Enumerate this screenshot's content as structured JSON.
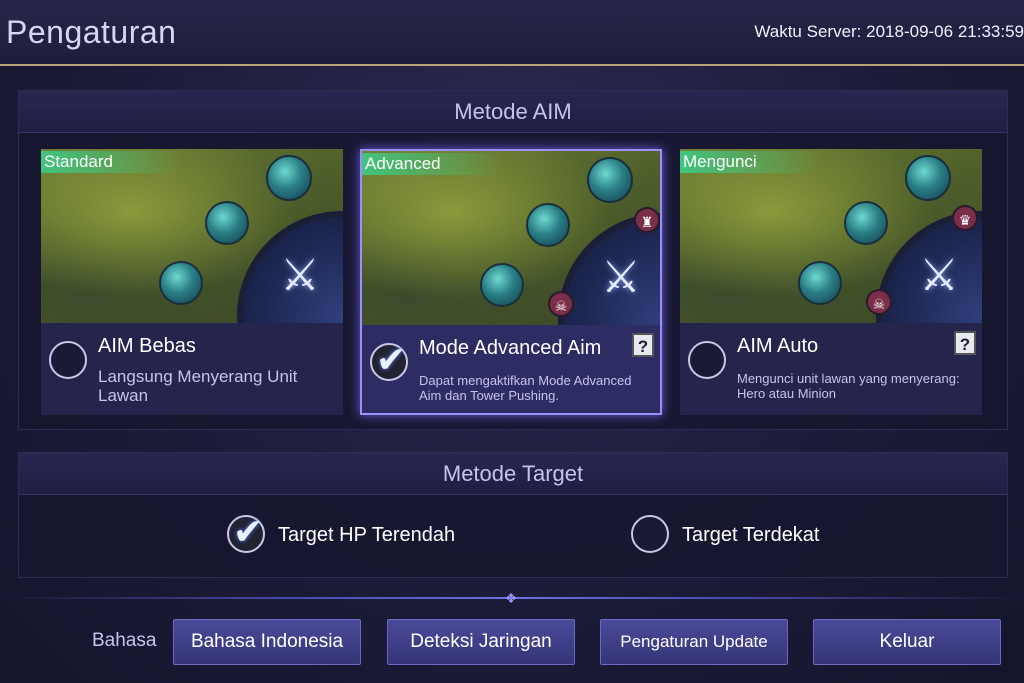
{
  "header": {
    "title": "Pengaturan",
    "server_time": "Waktu Server: 2018-09-06 21:33:59"
  },
  "aim_section": {
    "title": "Metode AIM",
    "cards": [
      {
        "tag": "Standard",
        "name": "AIM Bebas",
        "description": "Langsung Menyerang Unit Lawan",
        "selected": false
      },
      {
        "tag": "Advanced",
        "name": "Mode Advanced Aim",
        "description": "Dapat mengaktifkan Mode Advanced Aim dan Tower Pushing.",
        "selected": true,
        "help": "?"
      },
      {
        "tag": "Mengunci",
        "name": "AIM Auto",
        "description": "Mengunci unit lawan yang menyerang: Hero atau Minion",
        "selected": false,
        "help": "?"
      }
    ]
  },
  "target_section": {
    "title": "Metode Target",
    "options": [
      {
        "label": "Target HP Terendah",
        "selected": true
      },
      {
        "label": "Target Terdekat",
        "selected": false
      }
    ]
  },
  "footer": {
    "language_label": "Bahasa",
    "language_button": "Bahasa Indonesia",
    "network_button": "Deteksi Jaringan",
    "update_button": "Pengaturan Update",
    "exit_button": "Keluar"
  },
  "icons": {
    "check": "check-icon",
    "help": "help-icon",
    "skill": "skill-icon",
    "attack": "attack-icon"
  }
}
